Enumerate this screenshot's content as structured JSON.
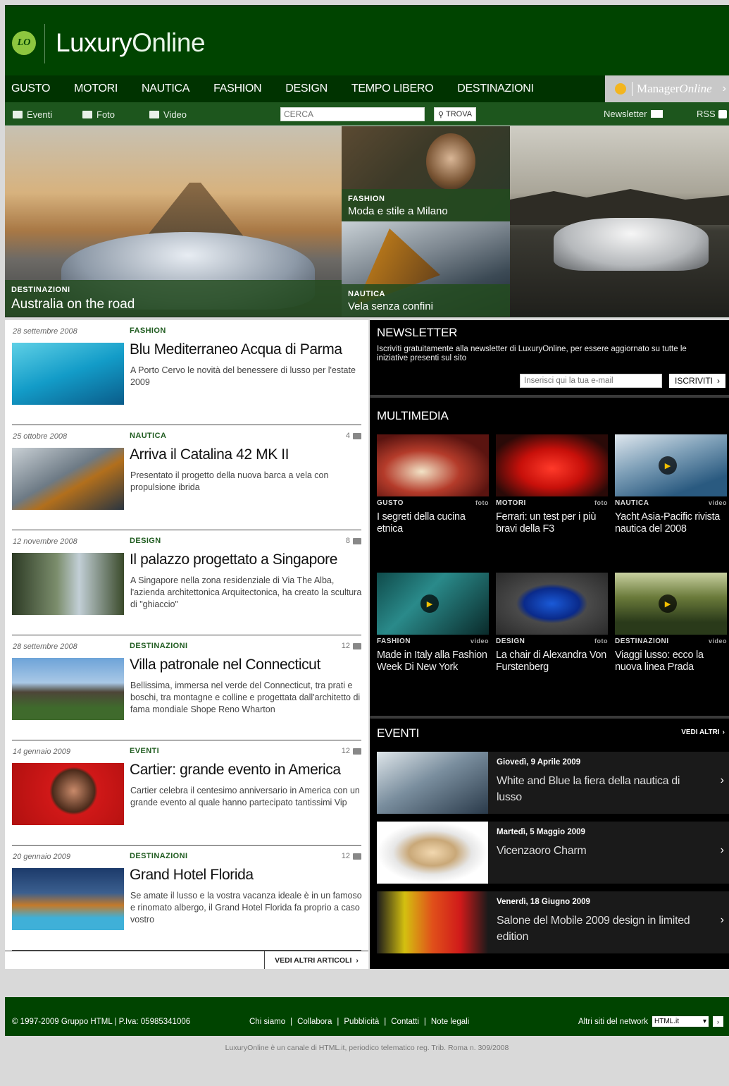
{
  "brand": {
    "badge": "LO",
    "name_bold": "Luxury",
    "name_light": "Online"
  },
  "nav": {
    "items": [
      "GUSTO",
      "MOTORI",
      "NAUTICA",
      "FASHION",
      "DESIGN",
      "TEMPO LIBERO",
      "DESTINAZIONI"
    ],
    "partner_a": "Manager",
    "partner_b": "Online",
    "partner_arrow": "›"
  },
  "subnav": {
    "eventi": "Eventi",
    "foto": "Foto",
    "video": "Video",
    "search_placeholder": "CERCA",
    "search_button": "TROVA",
    "newsletter": "Newsletter",
    "rss": "RSS"
  },
  "hero": {
    "main": {
      "category": "DESTINAZIONI",
      "title": "Australia on the road"
    },
    "fashion": {
      "category": "FASHION",
      "title": "Moda e stile a Milano"
    },
    "nautica": {
      "category": "NAUTICA",
      "title": "Vela senza confini"
    }
  },
  "articles": [
    {
      "date": "28 settembre 2008",
      "category": "FASHION",
      "comments": "",
      "title": "Blu Mediterraneo Acqua di Parma",
      "desc": "A Porto Cervo le novità del benessere di lusso per l'estate 2009"
    },
    {
      "date": "25 ottobre 2008",
      "category": "NAUTICA",
      "comments": "4",
      "title": "Arriva il Catalina 42 MK II",
      "desc": "Presentato il progetto della nuova barca a vela con propulsione ibrida"
    },
    {
      "date": "12 novembre 2008",
      "category": "DESIGN",
      "comments": "8",
      "title": "Il palazzo progettato a Singapore",
      "desc": "A Singapore nella zona residenziale di Via The Alba, l'azienda architettonica Arquitectonica, ha creato la scultura di \"ghiaccio\""
    },
    {
      "date": "28 settembre 2008",
      "category": "DESTINAZIONI",
      "comments": "12",
      "title": "Villa patronale nel Connecticut",
      "desc": "Bellissima, immersa nel verde del Connecticut, tra prati e boschi, tra montagne e colline e progettata dall'architetto di fama mondiale Shope Reno Wharton"
    },
    {
      "date": "14 gennaio 2009",
      "category": "EVENTI",
      "comments": "12",
      "title": "Cartier: grande evento in America",
      "desc": "Cartier celebra il centesimo anniversario in America con un grande evento al quale hanno partecipato tantissimi Vip"
    },
    {
      "date": "20 gennaio 2009",
      "category": "DESTINAZIONI",
      "comments": "12",
      "title": "Grand Hotel Florida",
      "desc": "Se amate il lusso e la vostra vacanza ideale è in un famoso e rinomato albergo, il Grand Hotel Florida fa proprio a caso vostro"
    }
  ],
  "more_articles": "VEDI ALTRI ARTICOLI",
  "newsletter": {
    "title": "NEWSLETTER",
    "text": "Iscriviti gratuitamente alla newsletter di LuxuryOnline, per essere aggiornato su tutte le iniziative presenti sul sito",
    "placeholder": "Inserisci qui la tua e-mail",
    "button": "ISCRIVITI"
  },
  "multimedia": {
    "title": "MULTIMEDIA",
    "items": [
      {
        "category": "GUSTO",
        "type": "foto",
        "title": "I segreti della cucina etnica"
      },
      {
        "category": "MOTORI",
        "type": "foto",
        "title": "Ferrari: un test per i più bravi della F3"
      },
      {
        "category": "NAUTICA",
        "type": "video",
        "title": "Yacht Asia-Pacific rivista nautica del 2008"
      },
      {
        "category": "FASHION",
        "type": "video",
        "title": "Made in Italy alla Fashion Week Di New York"
      },
      {
        "category": "DESIGN",
        "type": "foto",
        "title": "La chair di Alexandra Von Furstenberg"
      },
      {
        "category": "DESTINAZIONI",
        "type": "video",
        "title": "Viaggi lusso: ecco la nuova linea Prada"
      }
    ]
  },
  "eventi": {
    "title": "EVENTI",
    "more": "VEDI ALTRI",
    "items": [
      {
        "date": "Giovedì, 9 Aprile 2009",
        "title": "White and Blue la fiera della nautica di lusso"
      },
      {
        "date": "Martedì, 5 Maggio 2009",
        "title": "Vicenzaoro Charm"
      },
      {
        "date": "Venerdì, 18 Giugno 2009",
        "title": "Salone del Mobile 2009 design in limited edition"
      }
    ]
  },
  "footer": {
    "copyright": "© 1997-2009 Gruppo HTML | P.Iva: 05985341006",
    "links": [
      "Chi siamo",
      "Collabora",
      "Pubblicità",
      "Contatti",
      "Note legali"
    ],
    "network_label": "Altri siti del network",
    "network_value": "HTML.it",
    "legal": "LuxuryOnline è un canale di HTML.it, periodico telematico reg. Trib. Roma n. 309/2008"
  }
}
